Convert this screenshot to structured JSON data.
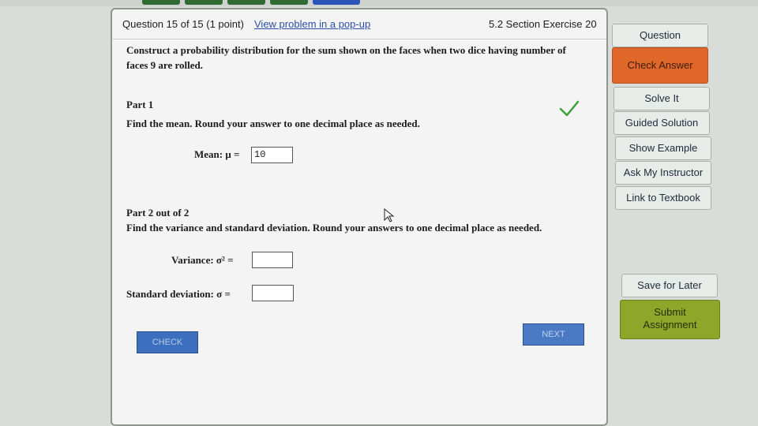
{
  "header": {
    "question_number": "Question 15 of 15 (1 point)",
    "popup_link": "View problem in a pop-up",
    "section": "5.2 Section Exercise 20"
  },
  "prompt": "Construct a probability distribution for the sum shown on the faces when two dice having number of faces 9 are rolled.",
  "part1": {
    "title": "Part 1",
    "instruction": "Find the mean. Round your answer to one decimal place as needed.",
    "mean_label": "Mean: μ =",
    "mean_value": "10",
    "status": "checkmark-icon"
  },
  "part2": {
    "title": "Part 2 out of 2",
    "instruction": "Find the variance and standard deviation. Round your answers to one decimal place as needed.",
    "variance_label": "Variance: σ² =",
    "variance_value": "",
    "sd_label": "Standard deviation: σ =",
    "sd_value": ""
  },
  "buttons": {
    "check": "CHECK",
    "next": "NEXT"
  },
  "sidebar": {
    "question": "Question",
    "check_answer": "Check Answer",
    "solve_it": "Solve It",
    "guided_solution": "Guided Solution",
    "show_example": "Show Example",
    "ask_instructor": "Ask My Instructor",
    "link_textbook": "Link to Textbook",
    "save_later": "Save for Later",
    "submit_line1": "Submit",
    "submit_line2": "Assignment"
  },
  "colors": {
    "check_answer": "#e0672a",
    "submit": "#8ea629",
    "primary_button": "#3d6fbf",
    "checkmark": "#3aa13a"
  }
}
